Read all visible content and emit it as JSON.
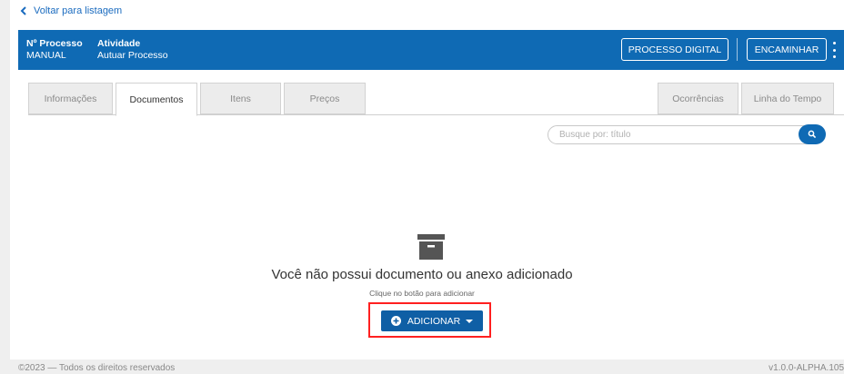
{
  "nav": {
    "back_label": "Voltar para listagem"
  },
  "header": {
    "processo_label": "Nº Processo",
    "processo_value": "MANUAL",
    "atividade_label": "Atividade",
    "atividade_value": "Autuar Processo",
    "btn_processo_digital": "PROCESSO DIGITAL",
    "btn_encaminhar": "ENCAMINHAR"
  },
  "tabs": [
    {
      "label": "Informações",
      "active": false
    },
    {
      "label": "Documentos",
      "active": true
    },
    {
      "label": "Itens",
      "active": false
    },
    {
      "label": "Preços",
      "active": false
    },
    {
      "label": "Ocorrências",
      "active": false
    },
    {
      "label": "Linha do Tempo",
      "active": false
    }
  ],
  "search": {
    "placeholder": "Busque por: título",
    "value": ""
  },
  "empty_state": {
    "title": "Você não possui documento ou anexo adicionado",
    "subtitle": "Clique no botão para adicionar",
    "add_button": "ADICIONAR"
  },
  "footer": {
    "copyright": "©2023 — Todos os direitos reservados",
    "version": "v1.0.0-ALPHA.105"
  },
  "colors": {
    "primary": "#0f6ab4",
    "highlight": "#ff2020"
  }
}
